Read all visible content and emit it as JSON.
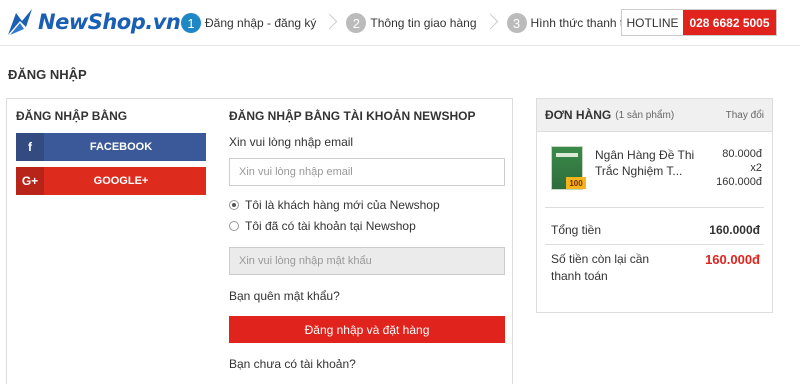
{
  "brand": {
    "name": "NewShop.vn",
    "color": "#1a5fb4"
  },
  "steps": [
    {
      "num": "1",
      "label": "Đăng nhập - đăng ký",
      "active": true
    },
    {
      "num": "2",
      "label": "Thông tin giao hàng",
      "active": false
    },
    {
      "num": "3",
      "label": "Hình thức thanh toán",
      "active": false
    }
  ],
  "hotline": {
    "label": "HOTLINE",
    "number": "028 6682 5005"
  },
  "page_title": "ĐĂNG NHẬP",
  "social": {
    "title": "ĐĂNG NHẬP BẰNG",
    "facebook": {
      "icon": "f",
      "label": "FACEBOOK",
      "color": "#3b5998"
    },
    "google": {
      "icon": "G+",
      "label": "GOOGLE+",
      "color": "#dd2c1e"
    }
  },
  "login_form": {
    "title": "ĐĂNG NHẬP BẰNG TÀI KHOẢN NEWSHOP",
    "email_hint": "Xin vui lòng nhập email",
    "email_placeholder": "Xin vui lòng nhập email",
    "radio_new": "Tôi là khách hàng mới của Newshop",
    "radio_existing": "Tôi đã có tài khoản tại Newshop",
    "password_placeholder": "Xin vui lòng nhập mật khẩu",
    "forgot_password": "Bạn quên mật khẩu?",
    "submit_label": "Đăng nhập và đặt hàng",
    "no_account": "Bạn chưa có tài khoản?",
    "accent_color": "#e0231d"
  },
  "order": {
    "title": "ĐƠN HÀNG",
    "count_text": "(1 sản phẩm)",
    "edit_label": "Thay đổi",
    "item": {
      "name": "Ngân Hàng Đề Thi Trắc Nghiệm T...",
      "unit_price": "80.000đ",
      "quantity": "x2",
      "line_total": "160.000đ",
      "thumb_badge": "100"
    },
    "total_label": "Tổng tiền",
    "total_value": "160.000đ",
    "remaining_label": "Số tiền còn lại cần thanh toán",
    "remaining_value": "160.000đ"
  }
}
